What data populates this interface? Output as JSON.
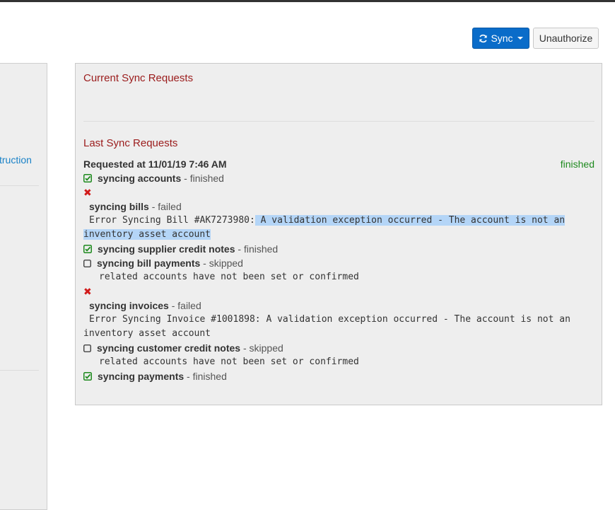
{
  "toolbar": {
    "sync_label": "Sync",
    "unauthorize_label": "Unauthorize"
  },
  "sidebar": {
    "link_text": "truction"
  },
  "panel": {
    "current_heading": "Current Sync Requests",
    "last_heading": "Last Sync Requests",
    "requested_at": "Requested at 11/01/19 7:46 AM",
    "request_status": "finished",
    "items": [
      {
        "icon": "check-icon",
        "name": "syncing accounts",
        "status": "- finished"
      },
      {
        "icon": "x-icon",
        "name": "syncing bills",
        "status": "- failed",
        "error_prefix": "Error Syncing Bill #AK7273980:",
        "error_highlight": " A validation exception occurred - The account is not an inventory asset account"
      },
      {
        "icon": "check-icon",
        "name": "syncing supplier credit notes",
        "status": "- finished"
      },
      {
        "icon": "square-icon",
        "name": "syncing bill payments",
        "status": "- skipped",
        "note": "related accounts have not been set or confirmed"
      },
      {
        "icon": "x-icon",
        "name": "syncing invoices",
        "status": "- failed",
        "error_text": "Error Syncing Invoice #1001898: A validation exception occurred - The account is not an inventory asset account"
      },
      {
        "icon": "square-icon",
        "name": "syncing customer credit notes",
        "status": "- skipped",
        "note": "related accounts have not been set or confirmed"
      },
      {
        "icon": "check-icon",
        "name": "syncing payments",
        "status": "- finished"
      }
    ]
  },
  "colors": {
    "accent": "#0a6cc9",
    "heading": "#9b1c1c",
    "success": "#1e8a1e",
    "error": "#d11a1a",
    "link": "#1a82c7"
  }
}
